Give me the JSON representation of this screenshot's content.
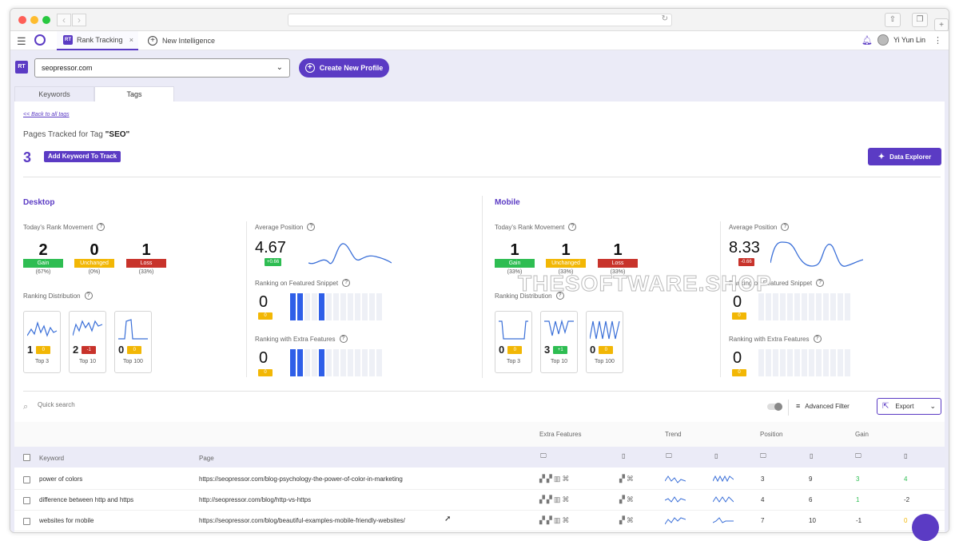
{
  "header": {
    "tab_active": "Rank Tracking",
    "tab_active_badge": "RT",
    "tab_close": "×",
    "tab_new": "New Intelligence",
    "user_name": "Yi Yun Lin"
  },
  "toolbar": {
    "badge": "RT",
    "profile_select": "seopressor.com",
    "create_button": "Create New Profile"
  },
  "tabs": {
    "keywords": "Keywords",
    "tags": "Tags"
  },
  "tag_page": {
    "back_link": "<< Back to all tags",
    "pages_tracked_label": "Pages Tracked for Tag",
    "tag_name": "\"SEO\"",
    "count": "3",
    "add_keyword_button": "Add Keyword To Track",
    "data_explorer_button": "Data Explorer"
  },
  "desktop": {
    "title": "Desktop",
    "rank_movement_label": "Today's Rank Movement",
    "movement": [
      {
        "value": "2",
        "label": "Gain",
        "pct": "(67%)"
      },
      {
        "value": "0",
        "label": "Unchanged",
        "pct": "(0%)"
      },
      {
        "value": "1",
        "label": "Loss",
        "pct": "(33%)"
      }
    ],
    "distribution_label": "Ranking Distribution",
    "distribution": [
      {
        "value": "1",
        "delta": "0",
        "caption": "Top 3"
      },
      {
        "value": "2",
        "delta": "-1",
        "caption": "Top 10"
      },
      {
        "value": "0",
        "delta": "0",
        "caption": "Top 100"
      }
    ],
    "avg_position_label": "Average Position",
    "avg_position": "4.67",
    "avg_delta": "+0.66",
    "snippet_label": "Ranking on Featured Snippet",
    "snippet_value": "0",
    "snippet_delta": "0",
    "extra_label": "Ranking with Extra Features",
    "extra_value": "0",
    "extra_delta": "0"
  },
  "mobile": {
    "title": "Mobile",
    "rank_movement_label": "Today's Rank Movement",
    "movement": [
      {
        "value": "1",
        "label": "Gain",
        "pct": "(33%)"
      },
      {
        "value": "1",
        "label": "Unchanged",
        "pct": "(33%)"
      },
      {
        "value": "1",
        "label": "Loss",
        "pct": "(33%)"
      }
    ],
    "distribution_label": "Ranking Distribution",
    "distribution": [
      {
        "value": "0",
        "delta": "0",
        "caption": "Top 3"
      },
      {
        "value": "3",
        "delta": "+1",
        "caption": "Top 10"
      },
      {
        "value": "0",
        "delta": "0",
        "caption": "Top 100"
      }
    ],
    "avg_position_label": "Average Position",
    "avg_position": "8.33",
    "avg_delta": "-0.66",
    "snippet_label": "Ranking on Featured Snippet",
    "snippet_value": "0",
    "snippet_delta": "0",
    "extra_label": "Ranking with Extra Features",
    "extra_value": "0",
    "extra_delta": "0"
  },
  "watermark": "THESOFTWARE.SHOP",
  "filters": {
    "search_placeholder": "Quick search",
    "advanced_filter": "Advanced Filter",
    "export": "Export"
  },
  "table": {
    "group_headers": {
      "extra_features": "Extra Features",
      "trend": "Trend",
      "position": "Position",
      "gain": "Gain"
    },
    "columns": {
      "keyword": "Keyword",
      "page": "Page"
    },
    "rows": [
      {
        "keyword": "power of colors",
        "page": "https://seopressor.com/blog-psychology-the-power-of-color-in-marketing",
        "pos_desktop": "3",
        "pos_mobile": "9",
        "gain_desktop": "3",
        "gain_mobile": "4"
      },
      {
        "keyword": "difference between http and https",
        "page": "http://seopressor.com/blog/http-vs-https",
        "pos_desktop": "4",
        "pos_mobile": "6",
        "gain_desktop": "1",
        "gain_mobile": "-2"
      },
      {
        "keyword": "websites for mobile",
        "page": "https://seopressor.com/blog/beautiful-examples-mobile-friendly-websites/",
        "pos_desktop": "7",
        "pos_mobile": "10",
        "gain_desktop": "-1",
        "gain_mobile": "0"
      }
    ]
  },
  "colors": {
    "accent": "#5b3bc4",
    "gain": "#2ebd52",
    "unchanged": "#f2b705",
    "loss": "#c8332b",
    "bar": "#2f5fe8"
  }
}
